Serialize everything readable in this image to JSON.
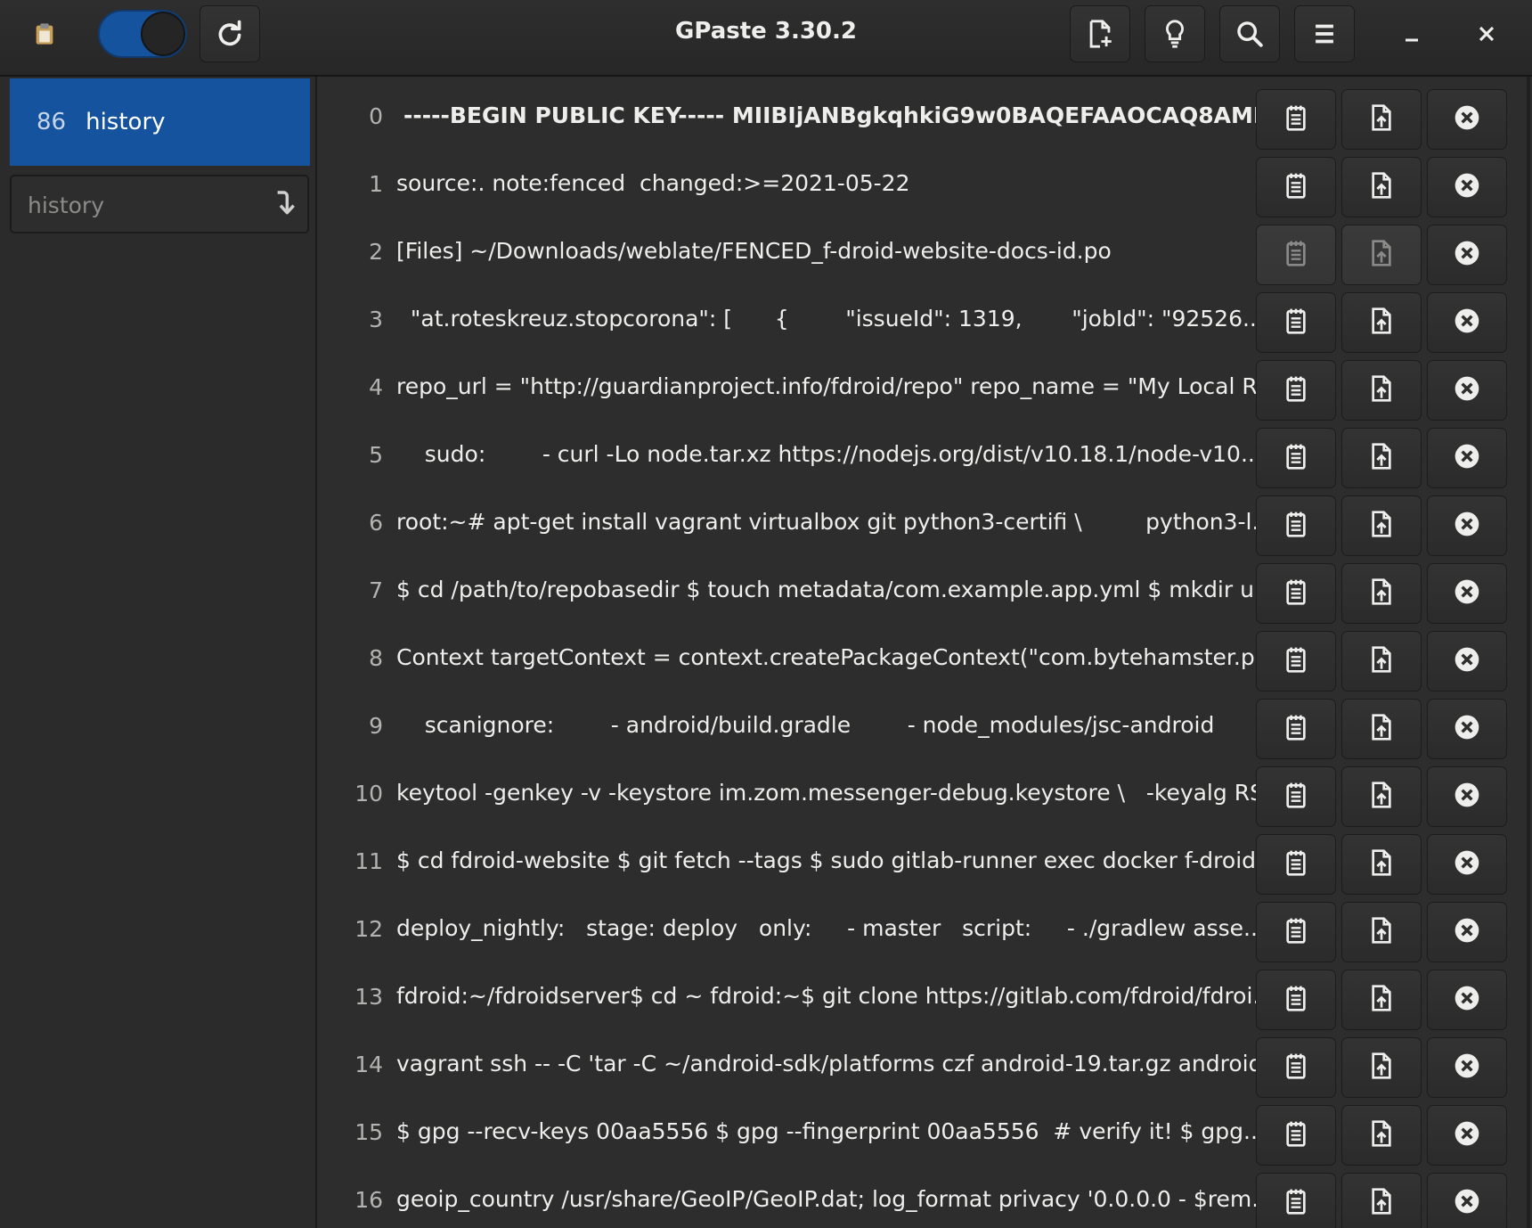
{
  "window": {
    "title": "GPaste 3.30.2"
  },
  "header": {
    "icons": {
      "app": "clipboard-icon",
      "refresh": "refresh-icon",
      "new": "new-document-icon",
      "about": "lightbulb-icon",
      "search": "search-icon",
      "menu": "hamburger-menu-icon",
      "minimize": "minimize-icon",
      "close": "close-icon"
    },
    "switch_on": true
  },
  "sidebar": {
    "selected": {
      "count": "86",
      "label": "history"
    },
    "entry_placeholder": "history"
  },
  "items": [
    {
      "index": "0",
      "text": "-----BEGIN PUBLIC KEY----- MIIBIjANBgkqhkiG9w0BAQEFAAOCAQ8AMII...",
      "bold": true
    },
    {
      "index": "1",
      "text": "source:. note:fenced  changed:>=2021-05-22"
    },
    {
      "index": "2",
      "text": "[Files] ~/Downloads/weblate/FENCED_f-droid-website-docs-id.po",
      "dim": true
    },
    {
      "index": "3",
      "text": "  \"at.roteskreuz.stopcorona\": [      {        \"issueId\": 1319,       \"jobId\": \"92526..."
    },
    {
      "index": "4",
      "text": "repo_url = \"http://guardianproject.info/fdroid/repo\" repo_name = \"My Local R..."
    },
    {
      "index": "5",
      "text": "    sudo:        - curl -Lo node.tar.xz https://nodejs.org/dist/v10.18.1/node-v10...."
    },
    {
      "index": "6",
      "text": "root:~# apt-get install vagrant virtualbox git python3-certifi \\         python3-l..."
    },
    {
      "index": "7",
      "text": "$ cd /path/to/repobasedir $ touch metadata/com.example.app.yml $ mkdir u..."
    },
    {
      "index": "8",
      "text": "Context targetContext = context.createPackageContext(\"com.bytehamster.p..."
    },
    {
      "index": "9",
      "text": "    scanignore:        - android/build.gradle        - node_modules/jsc-android         ..."
    },
    {
      "index": "10",
      "text": "keytool -genkey -v -keystore im.zom.messenger-debug.keystore \\   -keyalg RS..."
    },
    {
      "index": "11",
      "text": "$ cd fdroid-website $ git fetch --tags $ sudo gitlab-runner exec docker f-droid..."
    },
    {
      "index": "12",
      "text": "deploy_nightly:   stage: deploy   only:     - master   script:     - ./gradlew asse..."
    },
    {
      "index": "13",
      "text": "fdroid:~/fdroidserver$ cd ~ fdroid:~$ git clone https://gitlab.com/fdroid/fdroi..."
    },
    {
      "index": "14",
      "text": "vagrant ssh -- -C 'tar -C ~/android-sdk/platforms czf android-19.tar.gz android..."
    },
    {
      "index": "15",
      "text": "$ gpg --recv-keys 00aa5556 $ gpg --fingerprint 00aa5556  # verify it! $ gpg..."
    },
    {
      "index": "16",
      "text": "geoip_country /usr/share/GeoIP/GeoIP.dat; log_format privacy '0.0.0.0 - $rem..."
    }
  ],
  "row_icons": {
    "edit": "edit-note-icon",
    "upload": "upload-file-icon",
    "delete": "delete-circle-icon"
  }
}
